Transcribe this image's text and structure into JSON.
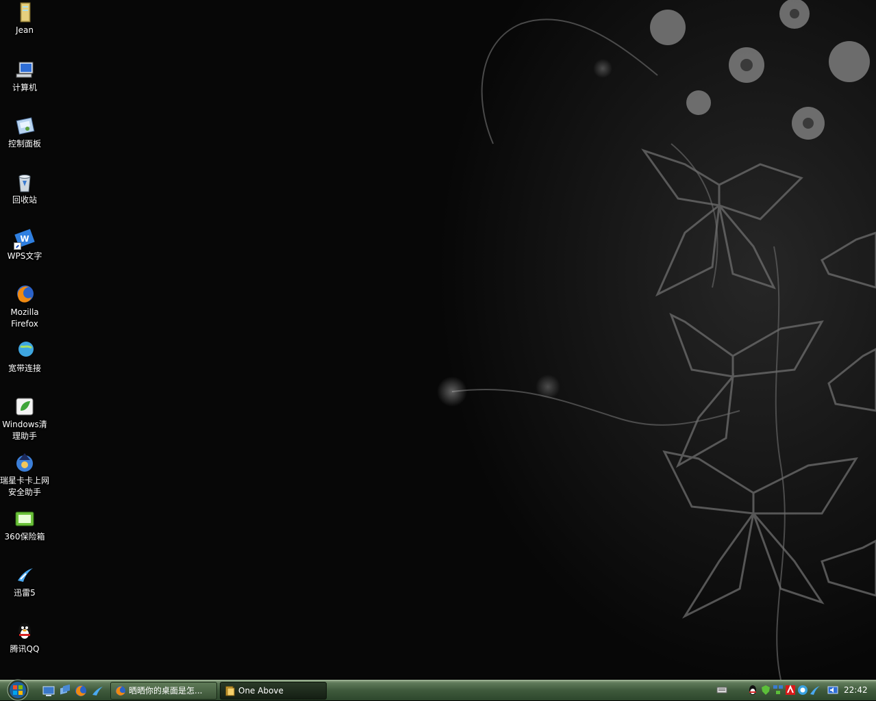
{
  "desktop": {
    "icons": [
      {
        "label": "Jean",
        "icon": "user-folder-icon"
      },
      {
        "label": "计算机",
        "icon": "computer-icon"
      },
      {
        "label": "控制面板",
        "icon": "control-panel-icon"
      },
      {
        "label": "回收站",
        "icon": "recycle-bin-icon"
      },
      {
        "label": "WPS文字",
        "icon": "wps-writer-icon"
      },
      {
        "label": "Mozilla Firefox",
        "icon": "firefox-icon"
      },
      {
        "label": "宽带连接",
        "icon": "broadband-connection-icon"
      },
      {
        "label": "Windows清理助手",
        "icon": "windows-cleaner-icon"
      },
      {
        "label": "瑞星卡卡上网安全助手",
        "icon": "rising-kaka-icon"
      },
      {
        "label": "360保险箱",
        "icon": "360-safebox-icon"
      },
      {
        "label": "迅雷5",
        "icon": "thunder-icon"
      },
      {
        "label": "腾讯QQ",
        "icon": "qq-icon"
      }
    ]
  },
  "taskbar": {
    "start_icon": "windows-start-orb-icon",
    "quick_launch": [
      "show-desktop-icon",
      "switch-windows-icon",
      "firefox-icon",
      "thunder-icon"
    ],
    "tasks": [
      {
        "label": "晒晒你的桌面是怎...",
        "icon": "firefox-icon",
        "active": false
      },
      {
        "label": "One Above",
        "icon": "folder-icon",
        "active": true
      }
    ],
    "tray_icons": [
      "keyboard-icon",
      "qq-icon",
      "shield-icon",
      "network-icon",
      "rising-icon",
      "360-icon",
      "thunder-icon",
      "volume-icon"
    ],
    "clock": "22:42"
  },
  "colors": {
    "taskbar": "#3f5a3c",
    "desktop_bg": "#060606"
  }
}
